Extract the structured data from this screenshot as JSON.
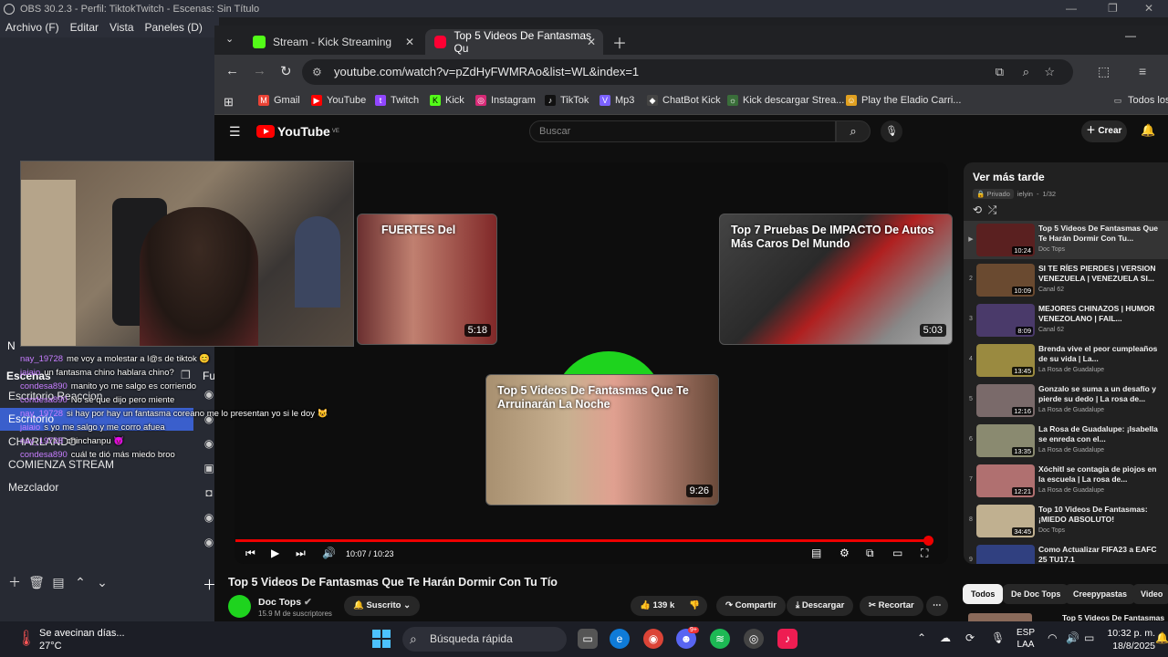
{
  "obs": {
    "title": "OBS 30.2.3 - Perfil: TiktokTwitch - Escenas: Sin Título",
    "menu": [
      "Archivo (F)",
      "Editar",
      "Vista",
      "Paneles (D)"
    ],
    "scenes_label": "Escenas",
    "sources_label": "Fu",
    "n_label": "N",
    "scenes": [
      "Escritorio Reaccion",
      "Escritorio",
      "CHARLANDO",
      "COMIENZA STREAM",
      "Mezclador"
    ],
    "selected_scene": 1
  },
  "chat": [
    {
      "user": "nay_19728",
      "msg": "me voy a molestar a l@s de tiktok 😊"
    },
    {
      "user": "jaiaio",
      "msg": "un fantasma chino hablara chino?"
    },
    {
      "user": "condesa890",
      "msg": "manito yo me salgo es corriendo"
    },
    {
      "user": "condesa890",
      "msg": "No sé que dijo pero miente"
    },
    {
      "user": "nay_19728",
      "msg": "si hay por hay un fantasma coreano me lo presentan yo si le doy 😺"
    },
    {
      "user": "jaiaio",
      "msg": "s yo me salgo y me corro afuea"
    },
    {
      "user": "nay_19728",
      "msg": "chinchanpu 😈"
    },
    {
      "user": "condesa890",
      "msg": "cuál te dió más miedo broo"
    }
  ],
  "browser": {
    "tabs": [
      {
        "label": "Stream - Kick Streaming",
        "color": "#53fc18"
      },
      {
        "label": "Top 5 Videos De Fantasmas Qu",
        "color": "#ff0033"
      }
    ],
    "url": "youtube.com/watch?v=pZdHyFWMRAo&list=WL&index=1",
    "bookmarks": [
      {
        "label": "Gmail",
        "color": "#ea4335",
        "glyph": "M"
      },
      {
        "label": "YouTube",
        "color": "#ff0000",
        "glyph": "▶"
      },
      {
        "label": "Twitch",
        "color": "#9146ff",
        "glyph": "t"
      },
      {
        "label": "Kick",
        "color": "#53fc18",
        "glyph": "K"
      },
      {
        "label": "Instagram",
        "color": "#d62976",
        "glyph": "◎"
      },
      {
        "label": "TikTok",
        "color": "#111111",
        "glyph": "♪"
      },
      {
        "label": "Mp3",
        "color": "#7b61ff",
        "glyph": "V"
      },
      {
        "label": "ChatBot Kick",
        "color": "#444444",
        "glyph": "◆"
      },
      {
        "label": "Kick descargar Strea...",
        "color": "#3a6e3a",
        "glyph": "☼"
      },
      {
        "label": "Play the Eladio Carri...",
        "color": "#e0a020",
        "glyph": "☺"
      }
    ],
    "all_bookmarks": "Todos los"
  },
  "youtube": {
    "logo": "YouTube",
    "region": "VE",
    "search_placeholder": "Buscar",
    "create": "Crear",
    "endcards": [
      {
        "title": "FUERTES Del",
        "duration": "5:18"
      },
      {
        "title": "Top 7 Pruebas De IMPACTO De Autos Más Caros Del Mundo",
        "duration": "5:03"
      },
      {
        "title": "Top 5 Videos De Fantasmas Que Te Arruinarán La Noche",
        "duration": "9:26"
      }
    ],
    "time": "10:07 / 10:23",
    "progress": 0.98,
    "video_title": "Top 5 Videos De Fantasmas Que Te Harán Dormir Con Tu Tío",
    "channel": "Doc Tops",
    "subs": "15.9 M de suscriptores",
    "subscribe": "Suscrito",
    "likes": "139 k",
    "share": "Compartir",
    "download": "Descargar",
    "clip": "Recortar",
    "playlist": {
      "title": "Ver más tarde",
      "privacy": "Privado",
      "owner": "ielyin",
      "position": "1/32",
      "items": [
        {
          "idx": "▶",
          "title": "Top 5 Videos De Fantasmas Que Te Harán Dormir Con Tu...",
          "channel": "Doc Tops",
          "duration": "10:24",
          "color": "#5a2020"
        },
        {
          "idx": "2",
          "title": "SI TE RÍES PIERDES | VERSION VENEZUELA | VENEZUELA SI...",
          "channel": "Canal 62",
          "duration": "10:09",
          "color": "#6a4a30"
        },
        {
          "idx": "3",
          "title": "MEJORES CHINAZOS | HUMOR VENEZOLANO | FAIL...",
          "channel": "Canal 62",
          "duration": "8:09",
          "color": "#4a3a6a"
        },
        {
          "idx": "4",
          "title": "Brenda vive el peor cumpleaños de su vida | La...",
          "channel": "La Rosa de Guadalupe",
          "duration": "13:45",
          "color": "#9a8a40"
        },
        {
          "idx": "5",
          "title": "Gonzalo se suma a un desafío y pierde su dedo | La rosa de...",
          "channel": "La Rosa de Guadalupe",
          "duration": "12:16",
          "color": "#7a6a6a"
        },
        {
          "idx": "6",
          "title": "La Rosa de Guadalupe: ¡Isabella se enreda con el...",
          "channel": "La Rosa de Guadalupe",
          "duration": "13:35",
          "color": "#8a8a70"
        },
        {
          "idx": "7",
          "title": "Xóchitl se contagia de piojos en la escuela | La rosa de...",
          "channel": "La Rosa de Guadalupe",
          "duration": "12:21",
          "color": "#b07070"
        },
        {
          "idx": "8",
          "title": "Top 10 Videos De Fantasmas: ¡MIEDO ABSOLUTO!",
          "channel": "Doc Tops",
          "duration": "34:45",
          "color": "#c0b090"
        },
        {
          "idx": "9",
          "title": "Como Actualizar FIFA23 a EAFC 25 TU17.1",
          "channel": "",
          "duration": "",
          "color": "#304080"
        }
      ]
    },
    "chips": [
      "Todos",
      "De Doc Tops",
      "Creepypastas",
      "Video"
    ],
    "next_peek": "Top 5 Videos De Fantasmas"
  },
  "taskbar": {
    "weather_desc": "Se avecinan días...",
    "weather_temp": "27°C",
    "search": "Búsqueda rápida",
    "lang": "ESP",
    "lang2": "LAA",
    "time": "10:32 p. m.",
    "date": "18/8/2025",
    "discord_badge": "9+"
  }
}
